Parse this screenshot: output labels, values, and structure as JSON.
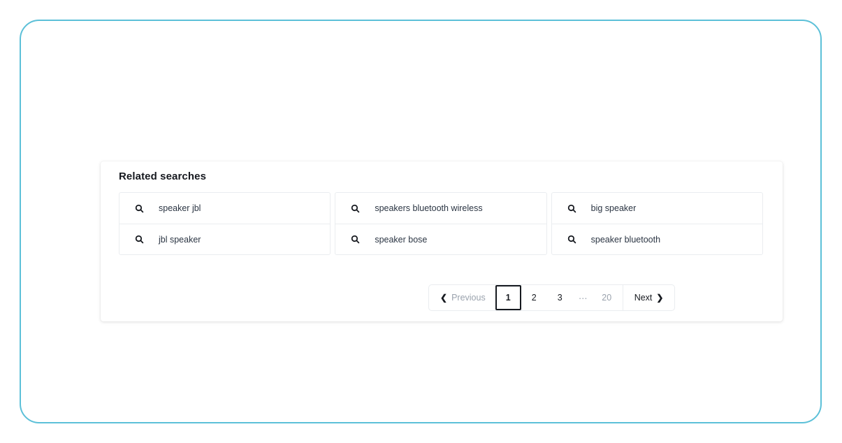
{
  "theme": {
    "frame_border_color": "#5cc0d8",
    "page_background": "#ffffff",
    "card_background": "#ffffff",
    "text_color": "#2b3543",
    "heading_color": "#16191f",
    "muted_color": "#9aa2ad",
    "divider_color": "#eaedf0"
  },
  "card": {
    "title": "Related searches",
    "columns": [
      {
        "items": [
          {
            "icon": "search-icon",
            "label": "speaker jbl"
          },
          {
            "icon": "search-icon",
            "label": "jbl speaker"
          }
        ]
      },
      {
        "items": [
          {
            "icon": "search-icon",
            "label": "speakers bluetooth wireless"
          },
          {
            "icon": "search-icon",
            "label": "speaker bose"
          }
        ]
      },
      {
        "items": [
          {
            "icon": "search-icon",
            "label": "big speaker"
          },
          {
            "icon": "search-icon",
            "label": "speaker bluetooth"
          }
        ]
      }
    ]
  },
  "pagination": {
    "previous_label": "Previous",
    "previous_icon": "chevron-left-icon",
    "next_label": "Next",
    "next_icon": "chevron-right-icon",
    "pages": [
      "1",
      "2",
      "3"
    ],
    "ellipsis": "⋯",
    "last_page": "20",
    "current_page": "1"
  }
}
